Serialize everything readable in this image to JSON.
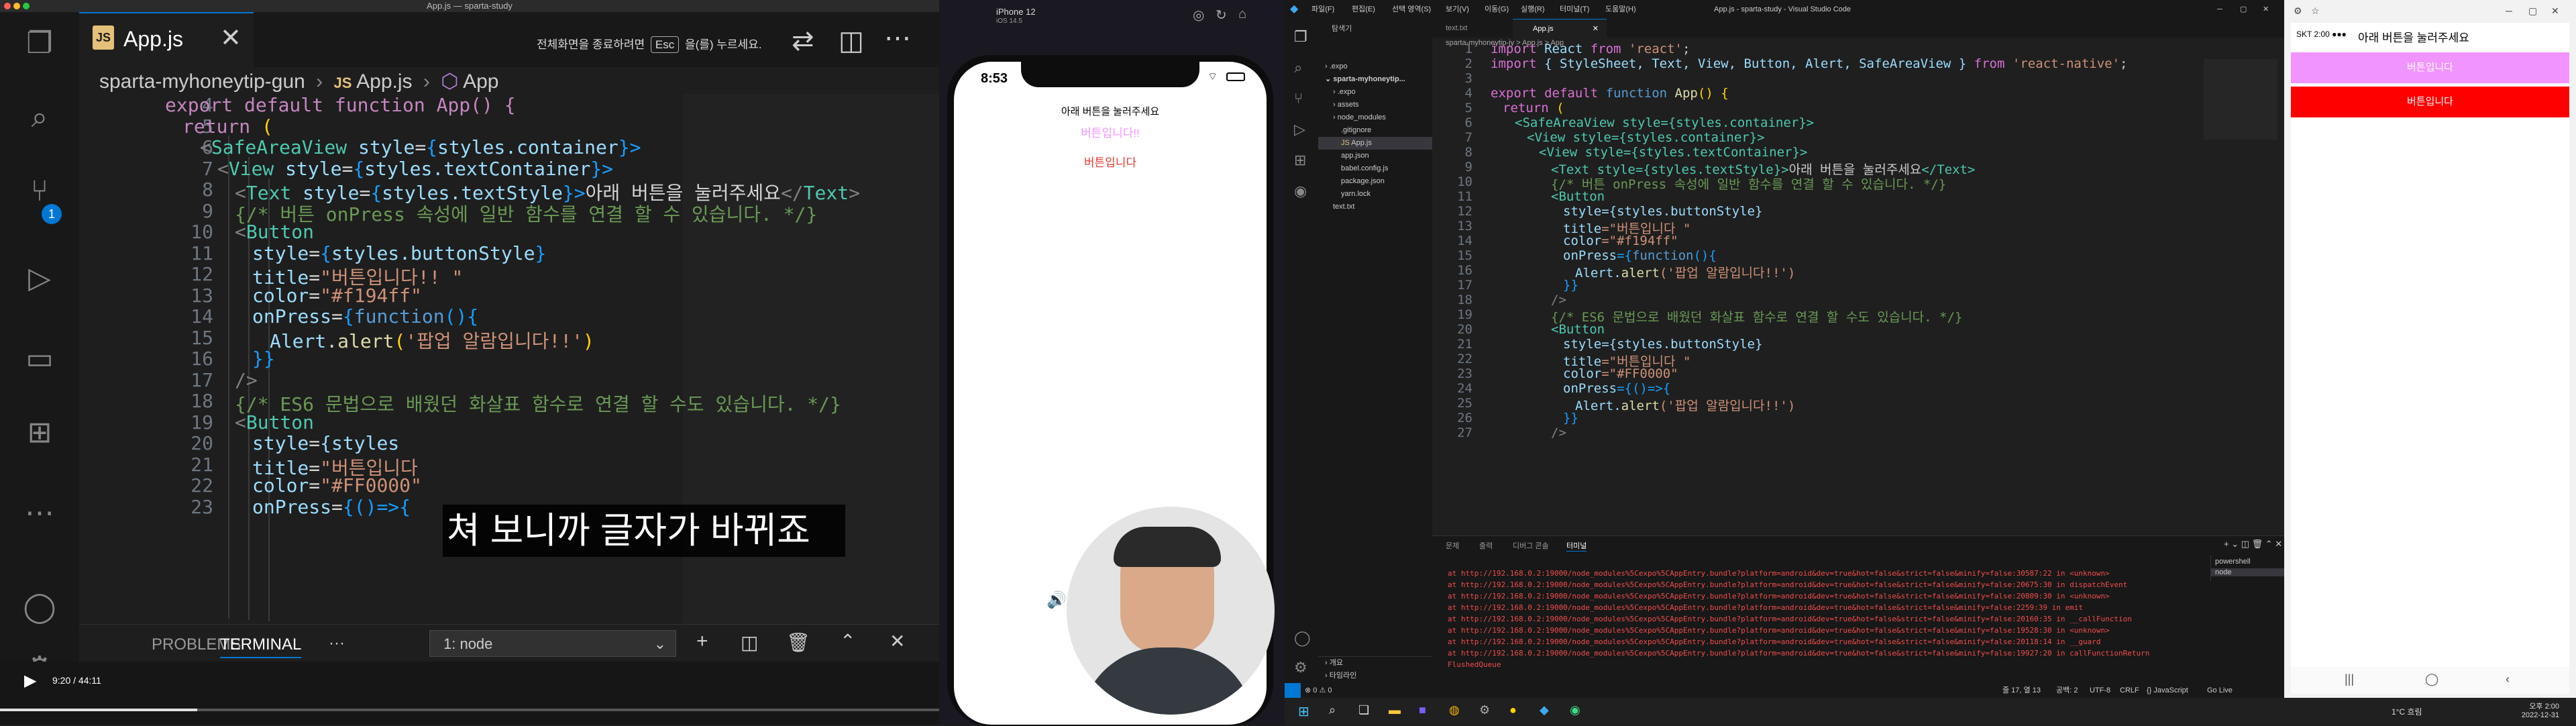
{
  "mac": {
    "window_title": "App.js — sparta-study",
    "tab_label": "App.js",
    "fullscreen_hint_prefix": "전체화면을 종료하려면",
    "fullscreen_hint_key": "Esc",
    "fullscreen_hint_suffix": "을(를) 누르세요.",
    "breadcrumb": [
      "sparta-myhoneytip-gun",
      "App.js",
      "App"
    ],
    "source_control_badge": "1",
    "line_numbers": [
      "4",
      "5",
      "6",
      "7",
      "8",
      "9",
      "10",
      "11",
      "12",
      "13",
      "14",
      "15",
      "16",
      "17",
      "18",
      "19",
      "20",
      "21",
      "22",
      "23"
    ],
    "code": {
      "l4": "export default function App() {",
      "l5_kw": "return",
      "l5_p": " (",
      "l6_a": "<",
      "l6_tag": "SafeAreaView",
      "l6_attr": " style",
      "l6_b": "=",
      "l6_c": "{",
      "l6_v": "styles.container",
      "l6_d": "}>",
      "l7_a": "<",
      "l7_tag": "View",
      "l7_attr": " style",
      "l7_b": "=",
      "l7_c": "{",
      "l7_v": "styles.textContainer",
      "l7_d": "}>",
      "l8_a": "<",
      "l8_tag": "Text",
      "l8_attr": " style",
      "l8_b": "=",
      "l8_c": "{",
      "l8_v": "styles.textStyle",
      "l8_d": "}>",
      "l8_text": "아래 버튼을 눌러주세요",
      "l8_e": "</",
      "l8_tag2": "Text",
      "l8_f": ">",
      "l9": "{/* 버튼 onPress 속성에 일반 함수를 연결 할 수 있습니다. */}",
      "l10_a": "<",
      "l10_tag": "Button",
      "l11_attr": "style",
      "l11_b": "=",
      "l11_c": "{",
      "l11_v": "styles.buttonStyle",
      "l11_d": "}",
      "l12_attr": "title",
      "l12_b": "=",
      "l12_s": "\"버튼입니다!! \"",
      "l13_attr": "color",
      "l13_b": "=",
      "l13_s": "\"#f194ff\"",
      "l14_attr": "onPress",
      "l14_b": "=",
      "l14_c": "{",
      "l14_k": "function",
      "l14_d": "(){",
      "l15_a": "Alert",
      "l15_b": ".",
      "l15_f": "alert",
      "l15_c": "(",
      "l15_s": "'팝업 알람입니다!!'",
      "l15_d": ")",
      "l16": "}}",
      "l17": "/>",
      "l18": "{/* ES6 문법으로 배웠던 화살표 함수로 연결 할 수도 있습니다. */}",
      "l19_a": "<",
      "l19_tag": "Button",
      "l20_attr": "style",
      "l20_b": "=",
      "l20_v": "{styles",
      "l21_attr": "title",
      "l21_b": "=",
      "l21_s": "\"버튼입니다",
      "l22_attr": "color",
      "l22_b": "=",
      "l22_s": "\"#FF0000\"",
      "l23_attr": "onPress",
      "l23_b": "=",
      "l23_c": "{",
      "l23_d": "()=>{"
    },
    "caption": "쳐 보니까 글자가 바뀌죠",
    "panel_tabs": [
      "PROBLEMS",
      "TERMINAL"
    ],
    "panel_more": "···",
    "terminal_select": "1: node",
    "video_time": "9:20 / 44:11",
    "video_progress": 0.21
  },
  "simulator": {
    "device_name": "iPhone 12",
    "ios_version": "iOS 14.5",
    "time": "8:53",
    "text": "아래 버튼을 눌러주세요",
    "button1": "버튼입니다!!",
    "button2": "버튼입니다"
  },
  "win": {
    "menu": [
      "파일(F)",
      "편집(E)",
      "선택 영역(S)",
      "보기(V)",
      "이동(G)",
      "실행(R)",
      "터미널(T)",
      "도움말(H)"
    ],
    "window_title": "App.js - sparta-study - Visual Studio Code",
    "explorer_title": "탐색기",
    "tabs": [
      "text.txt",
      "App.js"
    ],
    "breadcrumb": "sparta-myhoneytip-jy > App.js > App",
    "tree": [
      ".expo",
      "sparta-myhoneytip...",
      ".expo",
      "assets",
      "node_modules",
      ".gitignore",
      "App.js",
      "app.json",
      "babel.config.js",
      "package.json",
      "yarn.lock",
      "text.txt"
    ],
    "outline_label": "개요",
    "timeline_label": "타임라인",
    "line_numbers": [
      "1",
      "2",
      "3",
      "4",
      "5",
      "6",
      "7",
      "8",
      "9",
      "10",
      "11",
      "12",
      "13",
      "14",
      "15",
      "16",
      "17",
      "18",
      "19",
      "20",
      "21",
      "22",
      "23",
      "24",
      "25",
      "26",
      "27"
    ],
    "code": {
      "l1_k": "import",
      "l1_a": " React ",
      "l1_k2": "from",
      "l1_s": " 'react'",
      "l1_p": ";",
      "l2_k": "import",
      "l2_a": " { StyleSheet, Text, View, Button, Alert, SafeAreaView } ",
      "l2_k2": "from",
      "l2_s": " 'react-native'",
      "l2_p": ";",
      "l4_k": "export",
      "l4_k2": " default",
      "l4_k3": " function",
      "l4_f": " App",
      "l4_p": "() {",
      "l5_k": "return",
      "l5_p": " (",
      "l6": "<SafeAreaView style={styles.container}>",
      "l7": "<View style={styles.container}>",
      "l8": "<View style={styles.textContainer}>",
      "l9_a": "<Text style={styles.textStyle}>",
      "l9_t": "아래 버튼을 눌러주세요",
      "l9_b": "</Text>",
      "l10": "{/* 버튼 onPress 속성에 일반 함수를 연결 할 수 있습니다. */}",
      "l11": "<Button",
      "l12_a": "style",
      "l12_v": "={styles.buttonStyle}",
      "l13_a": "title",
      "l13_s": "=\"버튼입니다 \"",
      "l14_a": "color",
      "l14_s": "=\"#f194ff\"",
      "l15_a": "onPress",
      "l15_b": "={",
      "l15_k": "function",
      "l15_c": "(){",
      "l16_a": "Alert.",
      "l16_f": "alert",
      "l16_s": "('팝업 알람입니다!!')",
      "l17": "}}",
      "l18": "/>",
      "l19": "{/* ES6 문법으로 배웠던 화살표 함수로 연결 할 수도 있습니다. */}",
      "l20": "<Button",
      "l21_a": "style",
      "l21_v": "={styles.buttonStyle}",
      "l22_a": "title",
      "l22_s": "=\"버튼입니다 \"",
      "l23_a": "color",
      "l23_s": "=\"#FF0000\"",
      "l24_a": "onPress",
      "l24_b": "={()=>{",
      "l25_a": "Alert.",
      "l25_f": "alert",
      "l25_s": "('팝업 알람입니다!!')",
      "l26": "}}",
      "l27": "/>"
    },
    "panel_tabs": [
      "문제",
      "출력",
      "디버그 콘솔",
      "터미널"
    ],
    "terminals": [
      "powershell",
      "node"
    ],
    "errors": [
      "at http://192.168.0.2:19000/node_modules%5Cexpo%5CAppEntry.bundle?platform=android&dev=true&hot=false&strict=false&minify=false:30587:22 in <unknown>",
      "at http://192.168.0.2:19000/node_modules%5Cexpo%5CAppEntry.bundle?platform=android&dev=true&hot=false&strict=false&minify=false:20675:30 in dispatchEvent",
      "at http://192.168.0.2:19000/node_modules%5Cexpo%5CAppEntry.bundle?platform=android&dev=true&hot=false&strict=false&minify=false:20809:30 in <unknown>",
      "at http://192.168.0.2:19000/node_modules%5Cexpo%5CAppEntry.bundle?platform=android&dev=true&hot=false&strict=false&minify=false:2259:39 in emit",
      "at http://192.168.0.2:19000/node_modules%5Cexpo%5CAppEntry.bundle?platform=android&dev=true&hot=false&strict=false&minify=false:20160:35 in __callFunction",
      "at http://192.168.0.2:19000/node_modules%5Cexpo%5CAppEntry.bundle?platform=android&dev=true&hot=false&strict=false&minify=false:19528:30 in <unknown>",
      "at http://192.168.0.2:19000/node_modules%5Cexpo%5CAppEntry.bundle?platform=android&dev=true&hot=false&strict=false&minify=false:20118:14 in __guard",
      "at http://192.168.0.2:19000/node_modules%5Cexpo%5CAppEntry.bundle?platform=android&dev=true&hot=false&strict=false&minify=false:19927:20 in callFunctionReturn",
      "FlushedQueue"
    ],
    "status_left": "⊗ 0 ⚠ 0",
    "status_right": [
      "줄 17, 열 13",
      "공백: 2",
      "UTF-8",
      "CRLF",
      "{} JavaScript",
      "Go Live"
    ],
    "taskbar_weather": "1°C 흐림",
    "taskbar_time": "오후 2:00",
    "taskbar_date": "2022-12-31"
  },
  "emulator": {
    "status": "SKT 2:00 ●●● ",
    "text": "아래 버튼을 눌러주세요",
    "button1": "버튼입니다",
    "button2": "버튼입니다",
    "button1_color": "#f194ff",
    "button2_color": "#FF0000"
  }
}
